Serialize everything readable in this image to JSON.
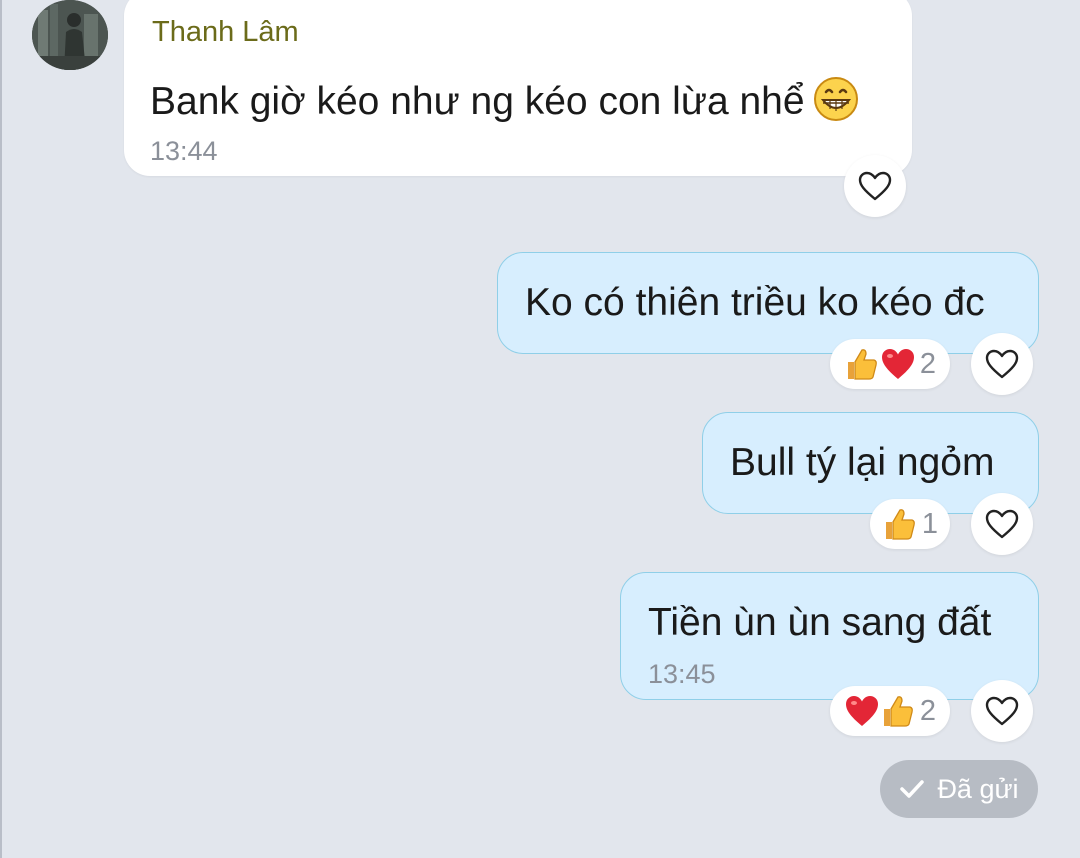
{
  "messages": [
    {
      "direction": "received",
      "sender": "Thanh Lâm",
      "text": "Bank giờ kéo như ng kéo con lừa nhể",
      "emoji": "grinning-face-icon",
      "time": "13:44"
    },
    {
      "direction": "sent",
      "text": "Ko có thiên triều ko kéo đc",
      "reactions": [
        "thumbs-up-icon",
        "red-heart-icon"
      ],
      "reaction_count": "2"
    },
    {
      "direction": "sent",
      "text": "Bull tý lại ngỏm",
      "reactions": [
        "thumbs-up-icon"
      ],
      "reaction_count": "1"
    },
    {
      "direction": "sent",
      "text": "Tiền ùn ùn sang đất",
      "time": "13:45",
      "reactions": [
        "red-heart-icon",
        "thumbs-up-icon"
      ],
      "reaction_count": "2"
    }
  ],
  "status": {
    "label": "Đã gửi",
    "icon": "check-icon"
  },
  "colors": {
    "background": "#e2e6ed",
    "received_bubble": "#ffffff",
    "sent_bubble": "#d7eefe",
    "sent_border": "#8fcfe8",
    "sender_name": "#6b6b1a",
    "time_text": "#8b9099",
    "status_pill": "#b7bcc4"
  }
}
